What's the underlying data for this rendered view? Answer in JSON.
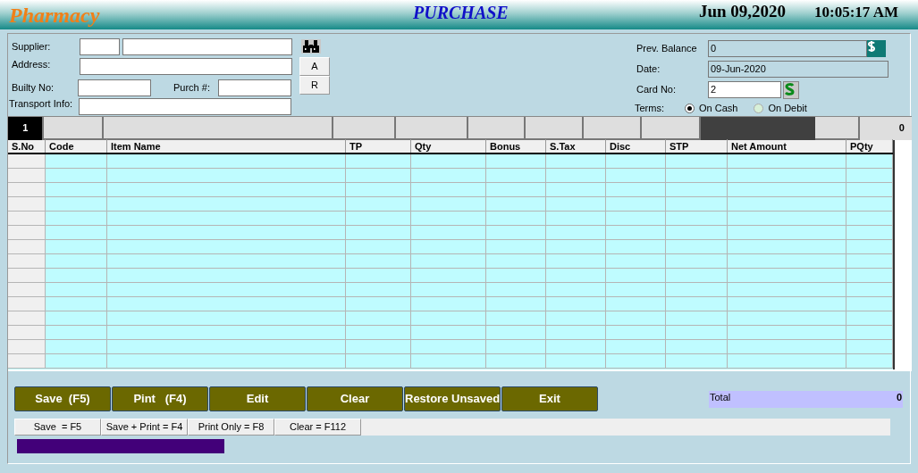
{
  "header": {
    "app_name": "Pharmacy",
    "title": "PURCHASE",
    "date": "Jun 09,2020",
    "time": "10:05:17 AM"
  },
  "supplier_form": {
    "supplier_label": "Supplier:",
    "address_label": "Address:",
    "builty_label": "Builty No:",
    "purch_label": "Purch #:",
    "transport_label": "Transport Info:",
    "side_buttons": [
      "A",
      "R"
    ]
  },
  "account": {
    "prev_balance_label": "Prev. Balance",
    "prev_balance": "0",
    "date_label": "Date:",
    "date": "09-Jun-2020",
    "card_label": "Card No:",
    "card_no": "2",
    "terms_label": "Terms:",
    "terms": [
      {
        "label": "On Cash",
        "selected": true
      },
      {
        "label": "On Debit",
        "selected": false
      }
    ]
  },
  "entry_row": {
    "number": "1",
    "total_qty": "0"
  },
  "table": {
    "columns": [
      "S.No",
      "Code",
      "Item Name",
      "TP",
      "Qty",
      "Bonus",
      "S.Tax",
      "Disc",
      "STP",
      "Net Amount",
      "PQty"
    ]
  },
  "buttons": [
    "Save  (F5)",
    "Pint   (F4)",
    "Edit",
    "Clear",
    "Restore Unsaved",
    "Exit"
  ],
  "total": {
    "label": "Total",
    "value": "0"
  },
  "shortcuts": [
    "Save  = F5",
    "Save + Print = F4",
    "Print Only = F8",
    "Clear = F112"
  ]
}
